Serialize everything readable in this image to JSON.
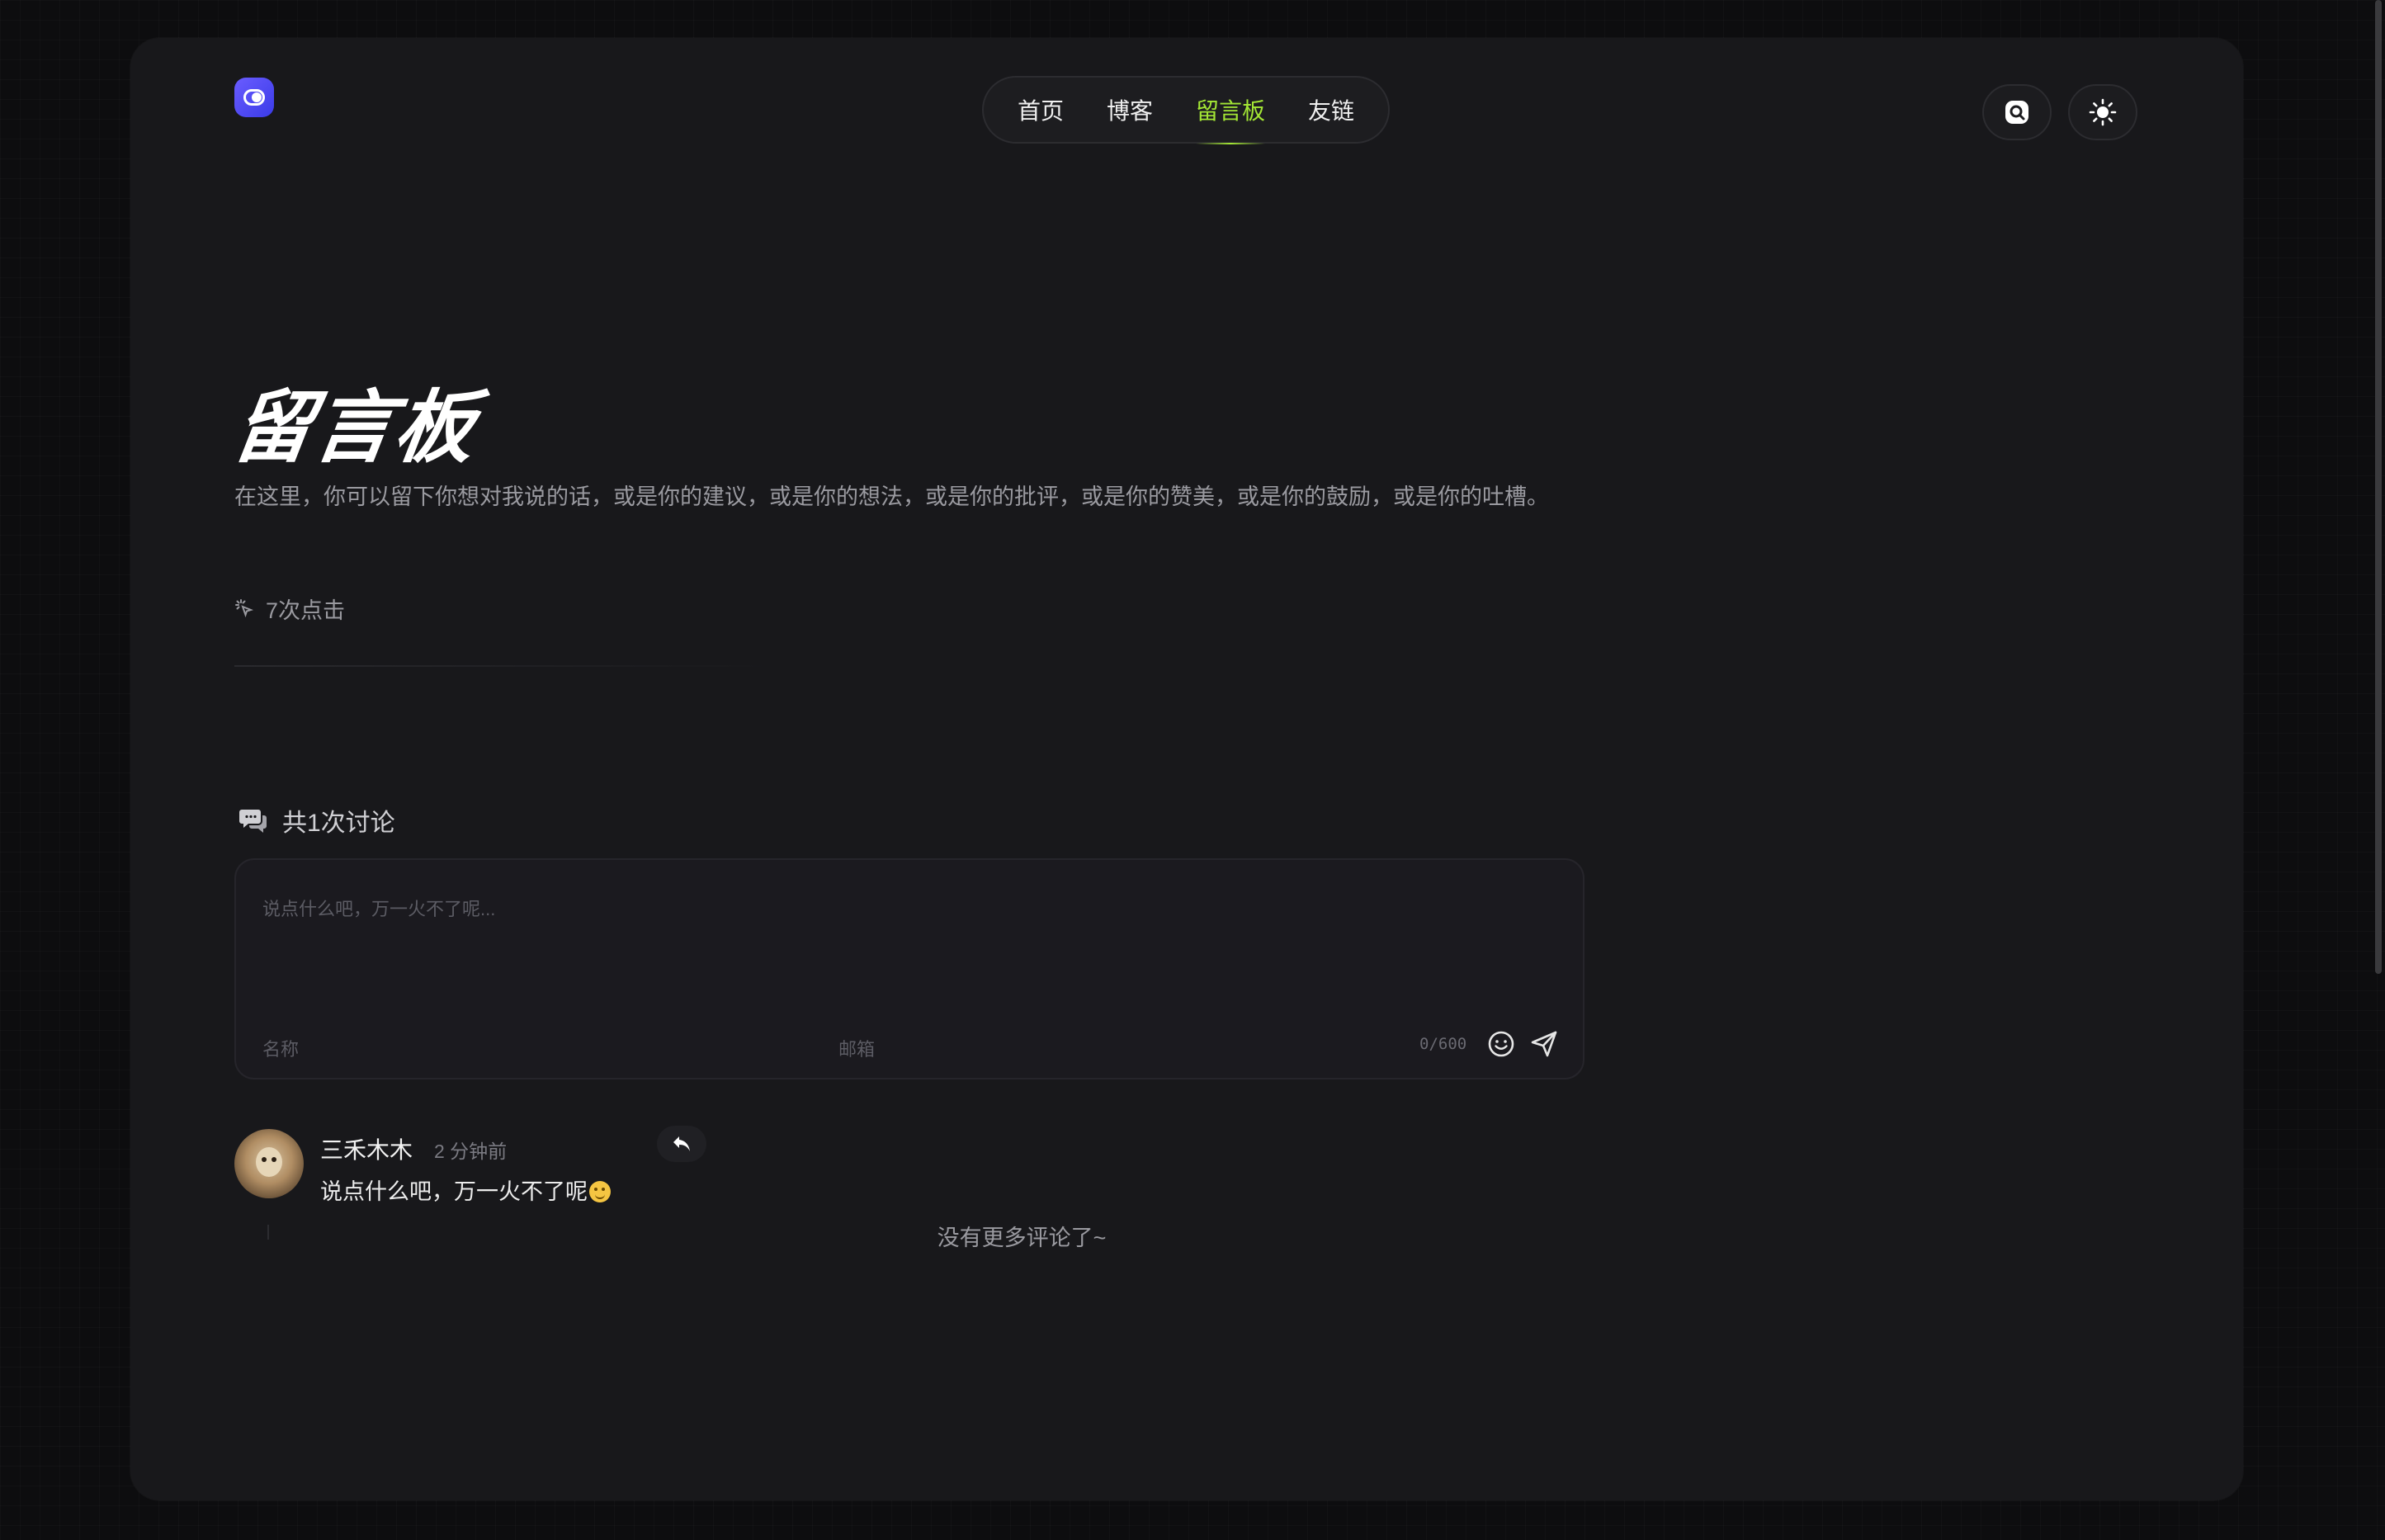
{
  "nav": {
    "items": [
      {
        "label": "首页"
      },
      {
        "label": "博客"
      },
      {
        "label": "留言板"
      },
      {
        "label": "友链"
      }
    ],
    "active": "留言板"
  },
  "header": {
    "logo_icon": "toggle-logo-icon",
    "search_icon": "search-icon",
    "theme_icon": "sun-icon"
  },
  "page": {
    "title": "留言板",
    "description": "在这里，你可以留下你想对我说的话，或是你的建议，或是你的想法，或是你的批评，或是你的赞美，或是你的鼓励，或是你的吐槽。",
    "clicks": "7次点击"
  },
  "discussion": {
    "count_label": "共1次讨论",
    "input_placeholder": "说点什么吧，万一火不了呢...",
    "name_placeholder": "名称",
    "email_placeholder": "邮箱",
    "counter": "0/600"
  },
  "comments": [
    {
      "author": "三禾木木",
      "time": "2 分钟前",
      "text": "说点什么吧，万一火不了呢"
    }
  ],
  "footer": {
    "no_more": "没有更多评论了~"
  },
  "colors": {
    "accent": "#a3e635",
    "logo": "#4f46e5",
    "background": "#18181b"
  }
}
